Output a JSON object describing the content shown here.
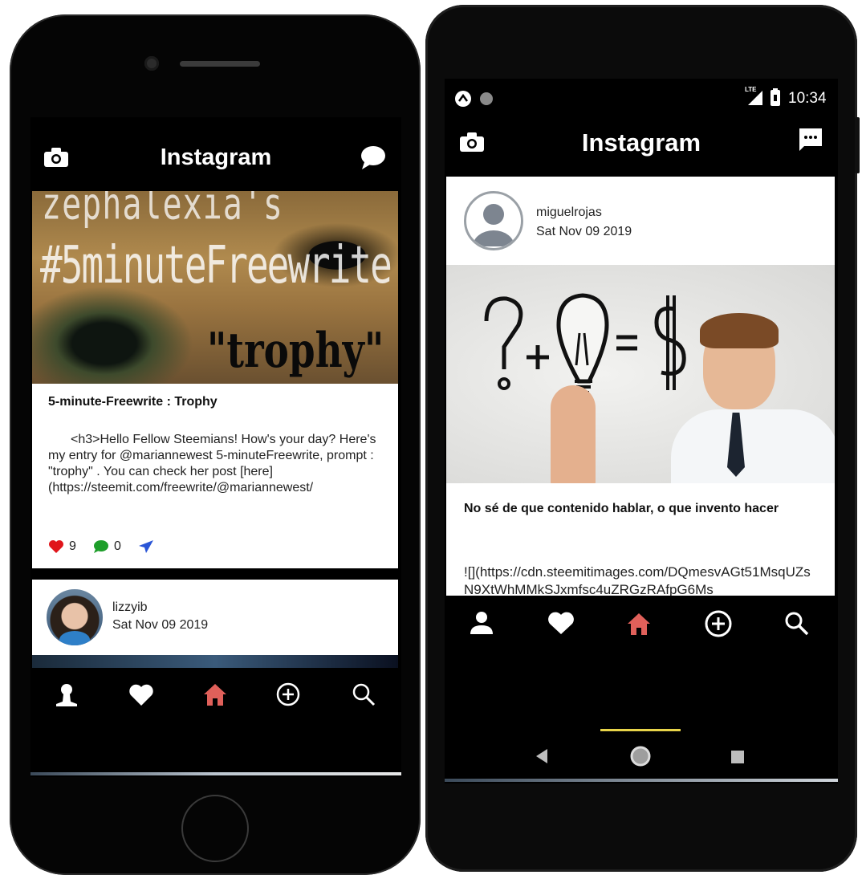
{
  "left_phone": {
    "app_title": "Instagram",
    "post1": {
      "image_text_line1": "zephalexia's",
      "image_text_line2": "#5minuteFreewrite",
      "image_text_line3": "\"trophy\"",
      "title": "5-minute-Freewrite : Trophy",
      "body": "<h3>Hello Fellow Steemians! How's  your day? Here's my entry for @mariannewest  5-minuteFreewrite,  prompt : \"trophy\" . You can check her post [here](https://steemit.com/freewrite/@mariannewest/",
      "likes": "9",
      "comments": "0"
    },
    "post2": {
      "username": "lizzyib",
      "date": "Sat Nov 09 2019"
    },
    "nav_icons": [
      "profile-icon",
      "heart-icon",
      "home-icon",
      "add-icon",
      "search-icon"
    ]
  },
  "right_phone": {
    "status_time": "10:34",
    "status_network": "LTE",
    "app_title": "Instagram",
    "post": {
      "username": "miguelrojas",
      "date": "Sat Nov 09 2019",
      "image_equation": "?+ = $",
      "title": "No sé de que contenido hablar, o que invento hacer",
      "body": "![](https://cdn.steemitimages.com/DQmesvAGt51MsqUZsN9XtWhMMkSJxmfsc4uZRGzRAfpG6Ms"
    },
    "nav_icons": [
      "profile-icon",
      "heart-icon",
      "home-icon",
      "add-icon",
      "search-icon"
    ]
  },
  "colors": {
    "active_home": "#e0605a",
    "like_red": "#e0151b",
    "comment_green": "#1e9e2a",
    "share_blue": "#2a55d6",
    "nav_indicator": "#e8d44a"
  }
}
